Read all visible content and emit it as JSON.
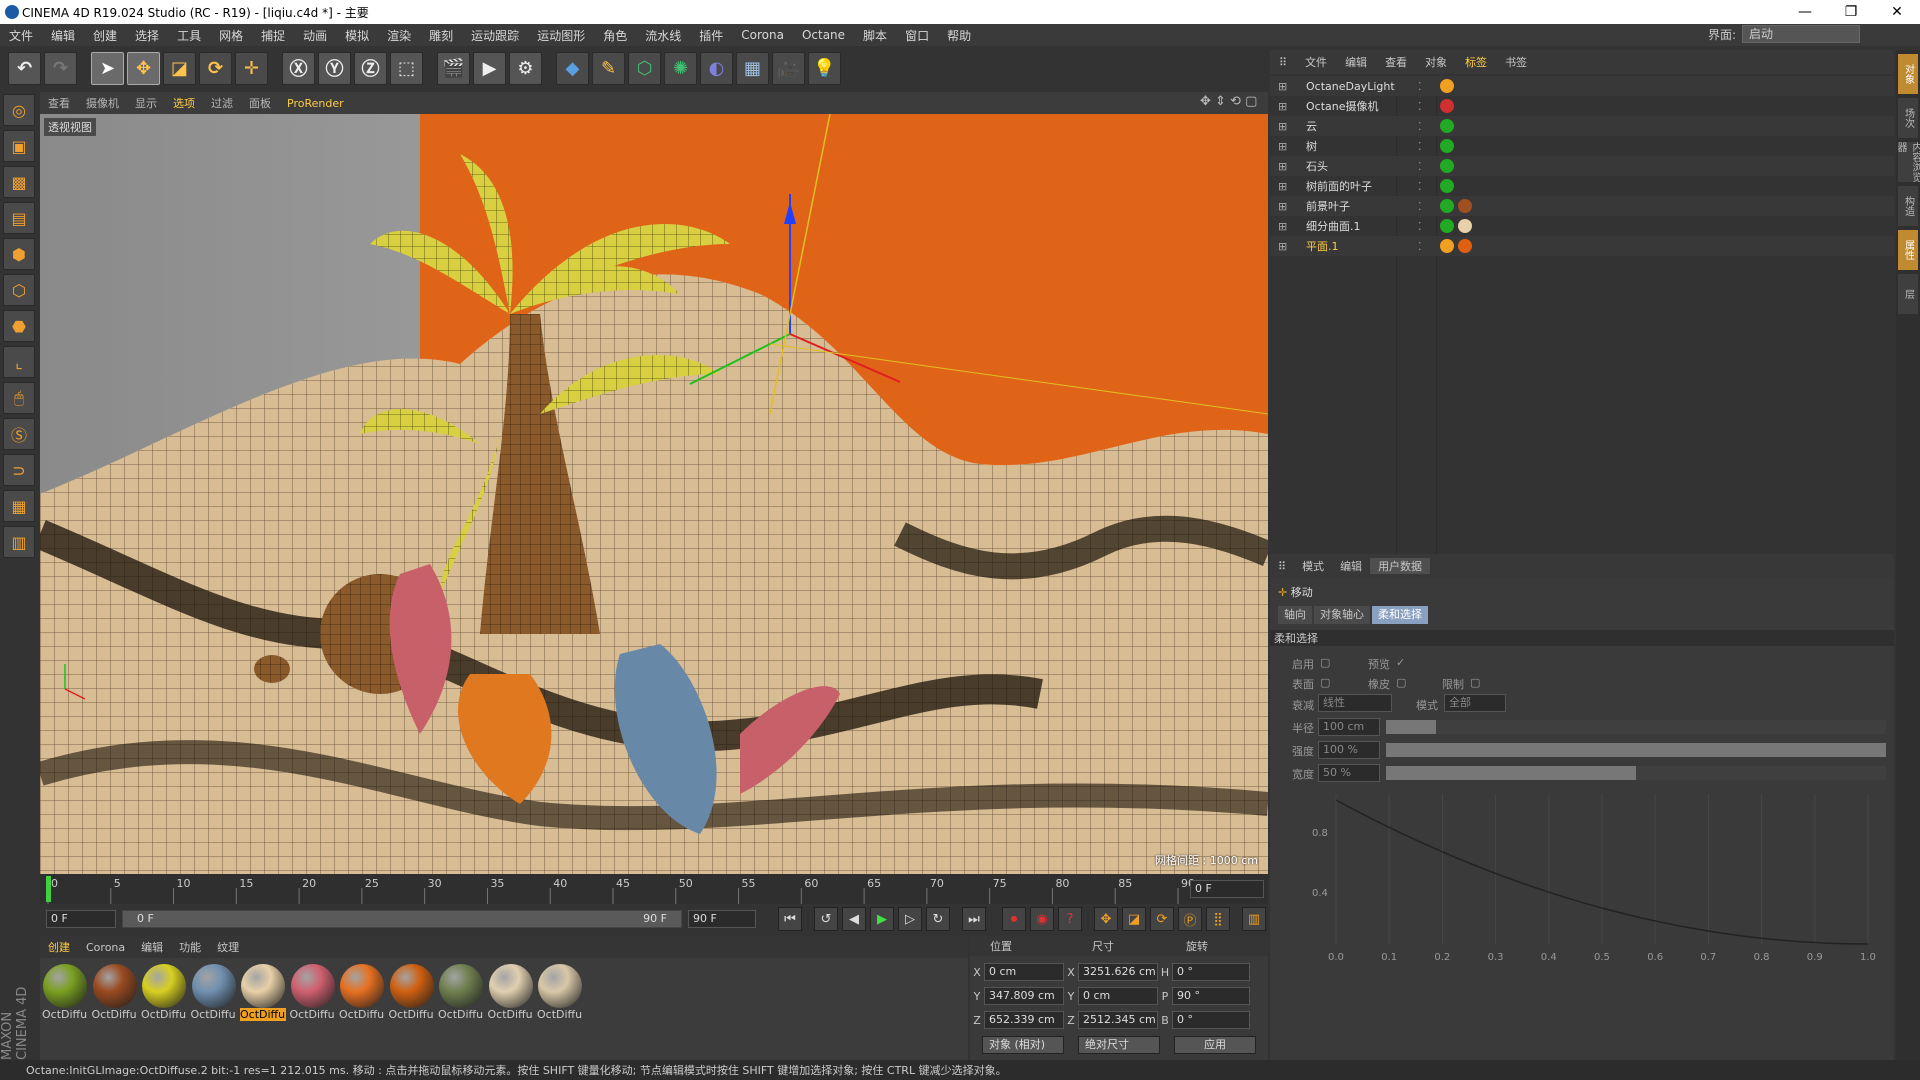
{
  "window": {
    "title": "CINEMA 4D R19.024 Studio (RC - R19) - [liqiu.c4d *] - 主要"
  },
  "menu": [
    "文件",
    "编辑",
    "创建",
    "选择",
    "工具",
    "网格",
    "捕捉",
    "动画",
    "模拟",
    "渲染",
    "雕刻",
    "运动跟踪",
    "运动图形",
    "角色",
    "流水线",
    "插件",
    "Corona",
    "Octane",
    "脚本",
    "窗口",
    "帮助"
  ],
  "layout": {
    "label": "界面:",
    "value": "启动"
  },
  "viewport": {
    "menu": [
      "查看",
      "摄像机",
      "显示",
      "选项",
      "过滤",
      "面板"
    ],
    "active_menu": "选项",
    "render_label": "ProRender",
    "view_label": "透视视图",
    "grid_text": "网格间距 : 1000 cm"
  },
  "timeline": {
    "ticks": [
      "0",
      "5",
      "10",
      "15",
      "20",
      "25",
      "30",
      "35",
      "40",
      "45",
      "50",
      "55",
      "60",
      "65",
      "70",
      "75",
      "80",
      "85",
      "90"
    ],
    "end_field": "0 F"
  },
  "transport": {
    "start": "0 F",
    "range_start": "0 F",
    "range_end": "90 F",
    "end": "90 F"
  },
  "materials": {
    "menu": [
      "创建",
      "Corona",
      "编辑",
      "功能",
      "纹理"
    ],
    "items": [
      {
        "label": "OctDiffu",
        "color": "#7aa020"
      },
      {
        "label": "OctDiffu",
        "color": "#9a4a20"
      },
      {
        "label": "OctDiffu",
        "color": "#d8d020"
      },
      {
        "label": "OctDiffu",
        "color": "#7090b0"
      },
      {
        "label": "OctDiffu",
        "color": "#e8d0a8",
        "selected": true
      },
      {
        "label": "OctDiffu",
        "color": "#d06070"
      },
      {
        "label": "OctDiffu",
        "color": "#e87020"
      },
      {
        "label": "OctDiffu",
        "color": "#d06010"
      },
      {
        "label": "OctDiffu",
        "color": "#708050"
      },
      {
        "label": "OctDiffu",
        "color": "#e0d0b0"
      },
      {
        "label": "OctDiffu",
        "color": "#d8c8a8"
      }
    ]
  },
  "coords": {
    "headers": [
      "位置",
      "尺寸",
      "旋转"
    ],
    "rows": [
      {
        "pl": "X",
        "pos": "0 cm",
        "sl": "X",
        "size": "3251.626 cm",
        "rl": "H",
        "rot": "0 °"
      },
      {
        "pl": "Y",
        "pos": "347.809 cm",
        "sl": "Y",
        "size": "0 cm",
        "rl": "P",
        "rot": "90 °"
      },
      {
        "pl": "Z",
        "pos": "652.339 cm",
        "sl": "Z",
        "size": "2512.345 cm",
        "rl": "B",
        "rot": "0 °"
      }
    ],
    "mode1": "对象 (相对)",
    "mode2": "绝对尺寸",
    "apply": "应用"
  },
  "status": "Octane:InitGLImage:OctDiffuse.2  bit:-1 res=1  212.015 ms.      移动 : 点击并拖动鼠标移动元素。按住 SHIFT 键量化移动; 节点编辑模式时按住 SHIFT 键增加选择对象; 按住 CTRL 键减少选择对象。",
  "objects": {
    "menu": [
      "文件",
      "编辑",
      "查看",
      "对象",
      "标签",
      "书签"
    ],
    "active_menu": "标签",
    "rows": [
      {
        "name": "OctaneDayLight",
        "tags": [
          "#f0a020"
        ]
      },
      {
        "name": "Octane摄像机",
        "tags": [
          "#d03030"
        ]
      },
      {
        "name": "云",
        "tags": [
          "#22aa22"
        ]
      },
      {
        "name": "树",
        "tags": [
          "#22aa22"
        ]
      },
      {
        "name": "石头",
        "tags": [
          "#22aa22"
        ]
      },
      {
        "name": "树前面的叶子",
        "tags": [
          "#22aa22"
        ]
      },
      {
        "name": "前景叶子",
        "tags": [
          "#22aa22",
          "#a05020"
        ]
      },
      {
        "name": "细分曲面.1",
        "tags": [
          "#22aa22",
          "#e8d0a8"
        ]
      },
      {
        "name": "平面.1",
        "tags": [
          "#f0a020",
          "#e06010"
        ],
        "selected": true
      }
    ]
  },
  "attributes": {
    "menu": [
      "模式",
      "编辑",
      "用户数据"
    ],
    "tool": "移动",
    "subtabs": [
      "轴向",
      "对象轴心",
      "柔和选择"
    ],
    "active_subtab": "柔和选择",
    "section": "柔和选择",
    "enable": "启用",
    "preview": "预览",
    "surface": "表面",
    "rubber": "橡皮",
    "limit": "限制",
    "falloff_label": "衰减",
    "falloff": "线性",
    "mode_label": "模式",
    "mode": "全部",
    "radius_label": "半径",
    "radius": "100 cm",
    "radius_frac": 0.1,
    "strength_label": "强度",
    "strength": "100 %",
    "strength_frac": 1.0,
    "width_label": "宽度",
    "width": "50 %",
    "width_frac": 0.5,
    "graph_y": [
      "0.8",
      "0.4"
    ],
    "graph_x": [
      "0.0",
      "0.1",
      "0.2",
      "0.3",
      "0.4",
      "0.5",
      "0.6",
      "0.7",
      "0.8",
      "0.9",
      "1.0"
    ]
  },
  "right_strip": [
    "对象",
    "场次",
    "内容浏览器",
    "构造",
    "属性",
    "层"
  ]
}
